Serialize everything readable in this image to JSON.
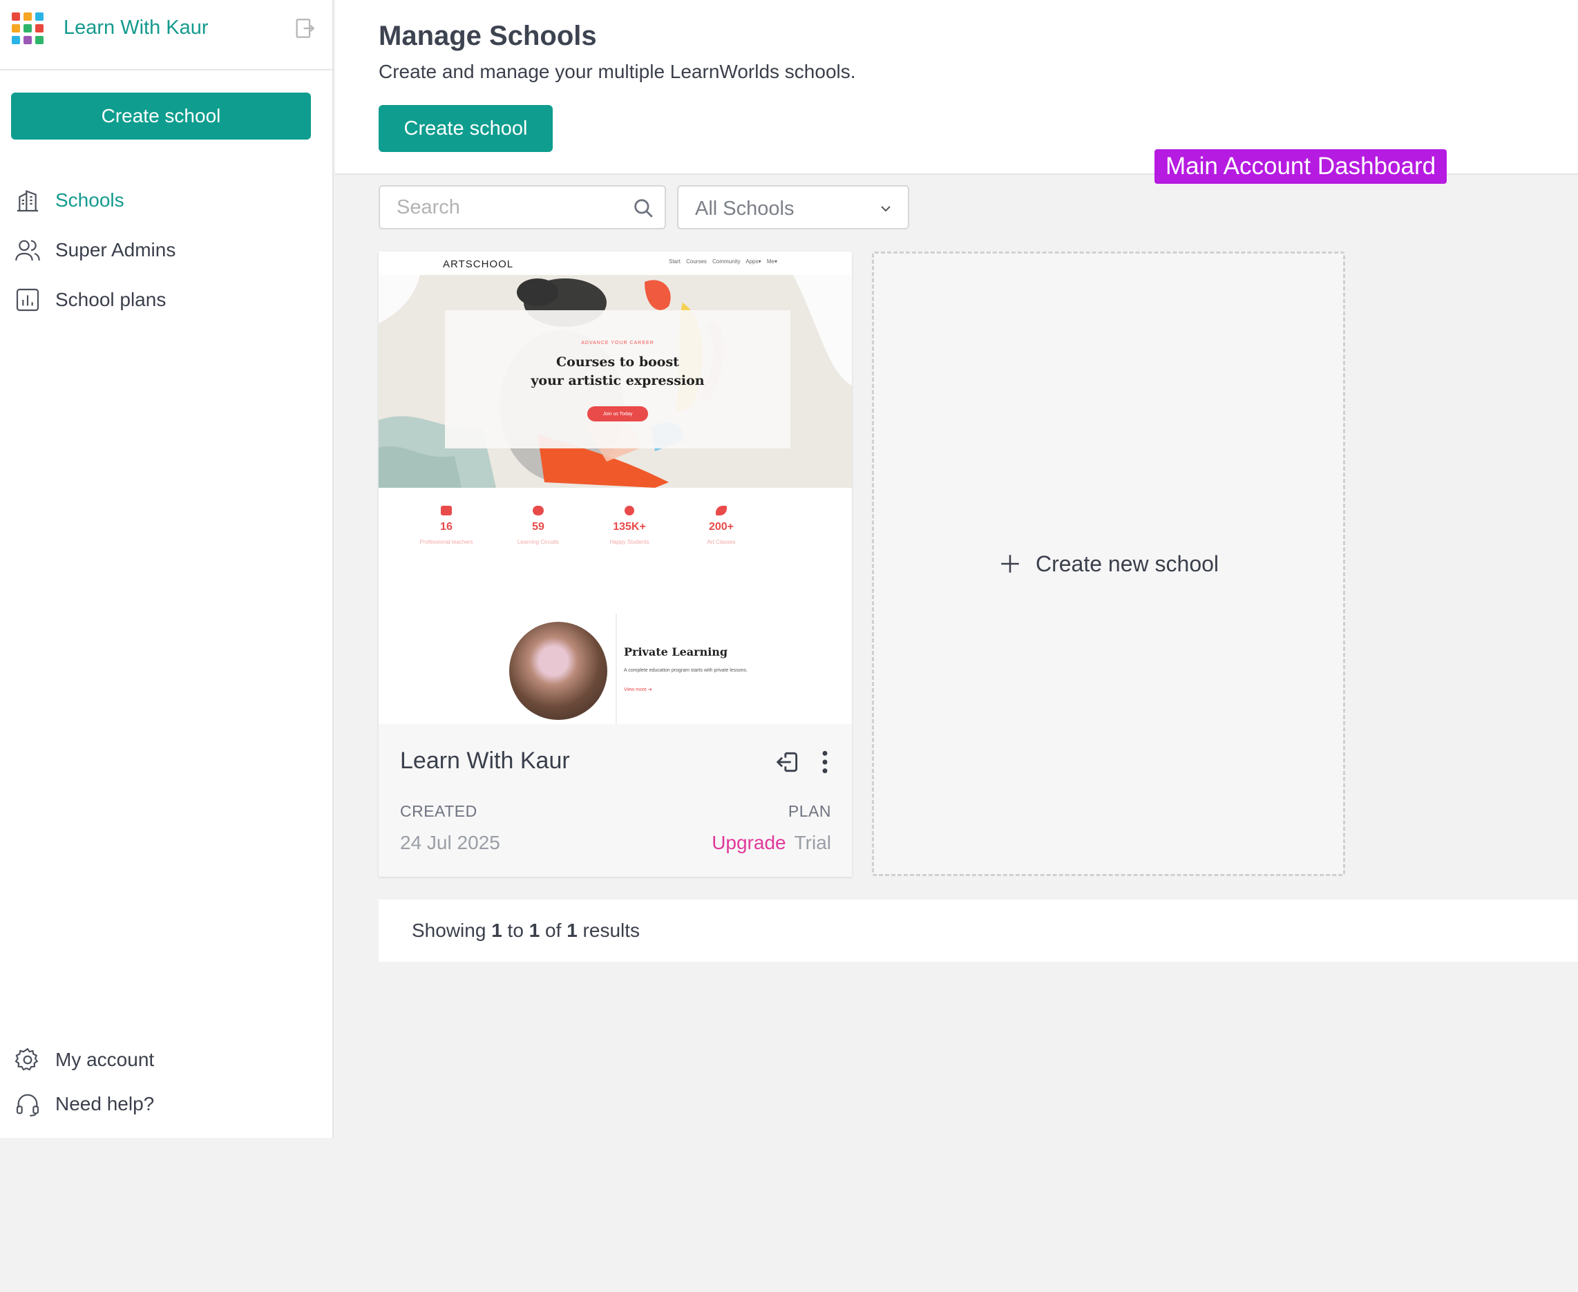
{
  "sidebar": {
    "brand_name": "Learn With Kaur",
    "create_button": "Create school",
    "nav": [
      {
        "label": "Schools",
        "icon": "building-icon",
        "active": true
      },
      {
        "label": "Super Admins",
        "icon": "users-icon",
        "active": false
      },
      {
        "label": "School plans",
        "icon": "bar-chart-icon",
        "active": false
      }
    ],
    "bottom_nav": [
      {
        "label": "My account",
        "icon": "gear-icon"
      },
      {
        "label": "Need help?",
        "icon": "headset-icon"
      }
    ]
  },
  "header": {
    "title": "Manage Schools",
    "subtitle": "Create and manage your multiple LearnWorlds schools.",
    "create_button": "Create school"
  },
  "callout": "Main Account Dashboard",
  "filters": {
    "search_placeholder": "Search",
    "select_value": "All Schools"
  },
  "school_card": {
    "name": "Learn With Kaur",
    "created_label": "CREATED",
    "created_value": "24 Jul 2025",
    "plan_label": "PLAN",
    "upgrade_link": "Upgrade",
    "plan_value": "Trial",
    "thumbnail": {
      "logo": "ARTSCHOOL",
      "nav_links": "Start Courses Community Apps▾ Me▾",
      "eyebrow": "ADVANCE YOUR CAREER",
      "headline_line1": "Courses to boost",
      "headline_line2": "your artistic expression",
      "cta": "Join us Today",
      "stats": [
        {
          "num": "16",
          "label": "Professional teachers"
        },
        {
          "num": "59",
          "label": "Learning Circuits"
        },
        {
          "num": "135K+",
          "label": "Happy Students"
        },
        {
          "num": "200+",
          "label": "Art Classes"
        }
      ],
      "private_title": "Private Learning",
      "private_text": "A complete education program starts with private lessons.",
      "private_link": "View more ➔"
    }
  },
  "new_tile_label": "Create new school",
  "results": {
    "prefix": "Showing",
    "from": "1",
    "to_word": "to",
    "to": "1",
    "of_word": "of",
    "total": "1",
    "suffix": "results"
  },
  "colors": {
    "accent": "#0f9d8f",
    "brand_text": "#149a8e",
    "callout": "#b61be1",
    "upgrade": "#e0399a"
  }
}
